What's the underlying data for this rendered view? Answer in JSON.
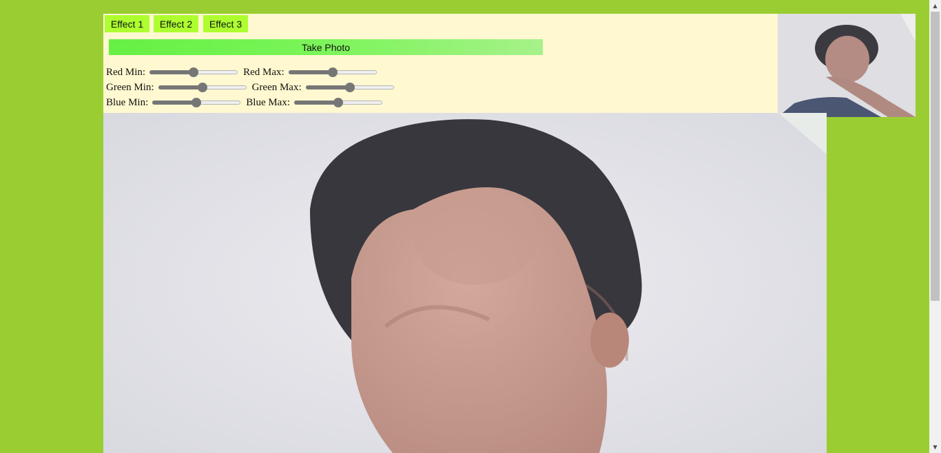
{
  "effects": {
    "buttons": [
      "Effect 1",
      "Effect 2",
      "Effect 3"
    ]
  },
  "take_photo_label": "Take Photo",
  "sliders": {
    "red_min_label": "Red Min:",
    "red_max_label": "Red Max:",
    "green_min_label": "Green Min:",
    "green_max_label": "Green Max:",
    "blue_min_label": "Blue Min:",
    "blue_max_label": "Blue Max:",
    "red_min_value": 0.5,
    "red_max_value": 0.5,
    "green_min_value": 0.5,
    "green_max_value": 0.5,
    "blue_min_value": 0.5,
    "blue_max_value": 0.5
  },
  "colors": {
    "page_background": "#9acd32",
    "panel_background": "#fff8d0",
    "effect_button": "#adff2f",
    "take_photo_gradient_start": "#66f044",
    "take_photo_gradient_end": "#a6f28a",
    "slider_fill": "#767676"
  }
}
